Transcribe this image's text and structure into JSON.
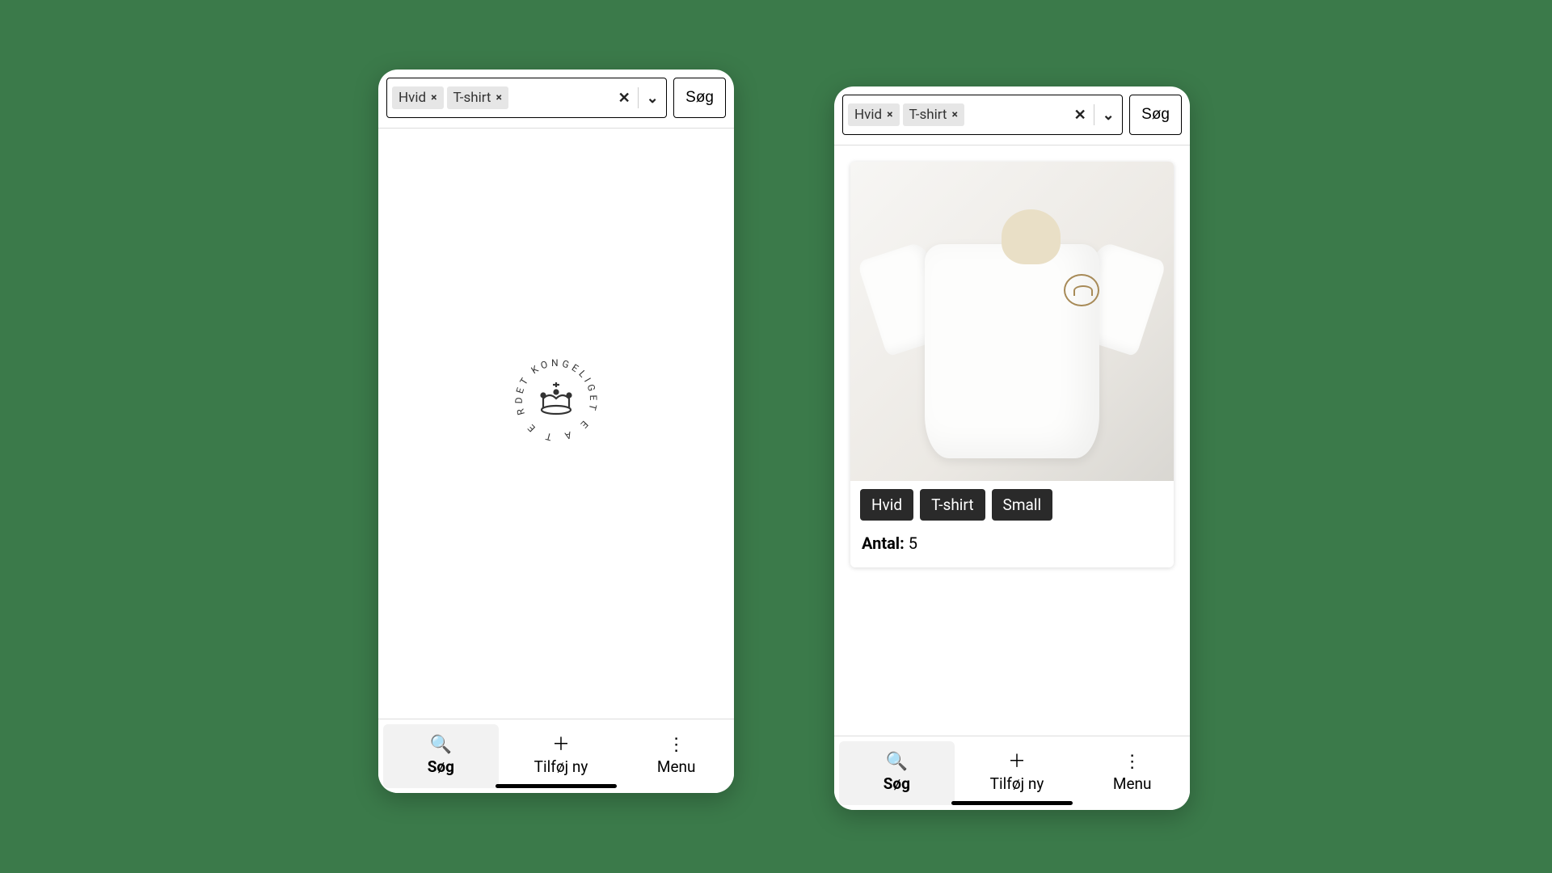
{
  "logo_text": "DET KONGELIGE TEATER",
  "search": {
    "chips": [
      "Hvid",
      "T-shirt"
    ],
    "chip_close": "×",
    "clear_icon": "✕",
    "dropdown_icon": "⌄",
    "button": "Søg"
  },
  "product": {
    "tags": [
      "Hvid",
      "T-shirt",
      "Small"
    ],
    "count_label": "Antal:",
    "count_value": "5"
  },
  "tabs": {
    "search": "Søg",
    "add": "Tilføj ny",
    "menu": "Menu",
    "icons": {
      "search": "🔍",
      "add": "＋",
      "menu": "⋮"
    }
  }
}
